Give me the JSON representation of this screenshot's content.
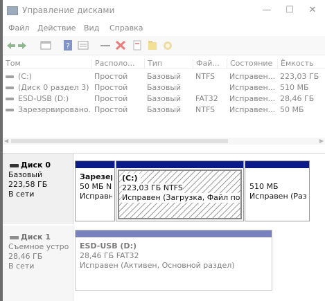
{
  "window": {
    "title": "Управление дисками",
    "controls": {
      "minimize": "—",
      "maximize": "☐",
      "close": "✕"
    }
  },
  "menu": [
    "Файл",
    "Действие",
    "Вид",
    "Справка"
  ],
  "toolbar": {
    "icons": [
      "back-arrow-icon",
      "forward-arrow-icon",
      "console-tree-icon",
      "help-icon",
      "refresh-icon",
      "connect-icon",
      "delete-icon",
      "properties-icon",
      "folder-icon",
      "wizard-icon"
    ]
  },
  "volumes": {
    "columns": [
      "Том",
      "Располо...",
      "Тип",
      "Фай...",
      "Состояние",
      "Ёмкость"
    ],
    "rows": [
      [
        "(C:)",
        "Простой",
        "Базовый",
        "NTFS",
        "Исправен...",
        "223,03 ГБ"
      ],
      [
        "(Диск 0 раздел 3)",
        "Простой",
        "Базовый",
        "",
        "Исправен...",
        "510 МБ"
      ],
      [
        "ESD-USB (D:)",
        "Простой",
        "Базовый",
        "FAT32",
        "Исправен...",
        "28,46 ГБ"
      ],
      [
        "Зарезервировано...",
        "Простой",
        "Базовый",
        "NTFS",
        "Исправен...",
        "50 МБ"
      ]
    ]
  },
  "disks": [
    {
      "name": "Диск 0",
      "type": "Базовый",
      "size": "223,58 ГБ",
      "status": "В сети",
      "partitions": [
        {
          "title": "Зарезер",
          "line1": "50 МБ N",
          "line2": "Исправн"
        },
        {
          "title": "(C:)",
          "line1": "223,03 ГБ NTFS",
          "line2": "Исправен (Загрузка, Файл подк"
        },
        {
          "title": "",
          "line1": "510 МБ",
          "line2": "Исправен (Раз"
        }
      ]
    },
    {
      "name": "Диск 1",
      "type": "Съемное устро",
      "size": "28,46 ГБ",
      "status": "В сети",
      "partitions": [
        {
          "title": "ESD-USB (D:)",
          "line1": "28,46 ГБ FAT32",
          "line2": "Исправен (Активен, Основной раздел)"
        }
      ]
    }
  ],
  "colors": {
    "partition_bar": "#0a1a8a",
    "background_dim": "#6d6d6d"
  }
}
